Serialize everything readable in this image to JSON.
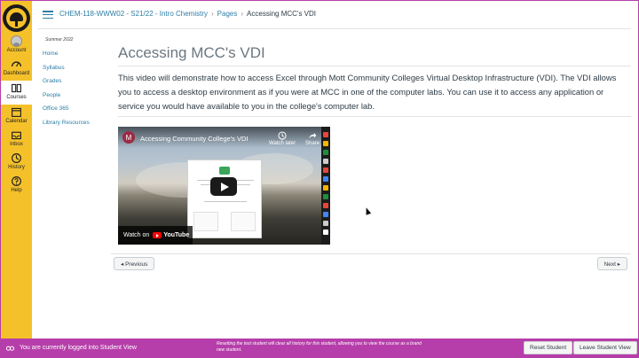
{
  "global_nav": {
    "items": [
      {
        "label": "Account",
        "icon": "account-avatar-icon"
      },
      {
        "label": "Dashboard",
        "icon": "dashboard-icon"
      },
      {
        "label": "Courses",
        "icon": "courses-icon"
      },
      {
        "label": "Calendar",
        "icon": "calendar-icon"
      },
      {
        "label": "Inbox",
        "icon": "inbox-icon"
      },
      {
        "label": "History",
        "icon": "history-icon"
      },
      {
        "label": "Help",
        "icon": "help-icon"
      }
    ],
    "colors": {
      "background": "#f5c12a",
      "text": "#1f1f1f"
    }
  },
  "breadcrumb": {
    "course": "CHEM-118-WWW02 - S21/22 - Intro Chemistry",
    "section": "Pages",
    "current": "Accessing MCC's VDI"
  },
  "course_nav": {
    "term": "Summer 2022",
    "items": [
      "Home",
      "Syllabus",
      "Grades",
      "People",
      "Office 365",
      "Library Resources"
    ]
  },
  "page": {
    "title": "Accessing MCC's VDI",
    "body": "This video will demonstrate how to access Excel through Mott Community Colleges Virtual Desktop Infrastructure (VDI). The VDI allows you to access a desktop environment as if you were at MCC in one of the computer labs. You can use it to access any application or service you would have available to you in the college's computer lab."
  },
  "video": {
    "channel_initial": "M",
    "title": "Accessing Community College's VDI",
    "watch_later": "Watch later",
    "share": "Share",
    "watch_on": "Watch on",
    "youtube": "YouTube"
  },
  "pager": {
    "previous": "◂ Previous",
    "next": "Next ▸"
  },
  "student_view": {
    "message": "You are currently logged into Student View",
    "note": "Resetting the test student will clear all history for this student, allowing you to view the course as a brand new student.",
    "reset_label": "Reset Student",
    "leave_label": "Leave Student View",
    "color": "#b63eaa"
  },
  "link_color": "#2d7ea6"
}
